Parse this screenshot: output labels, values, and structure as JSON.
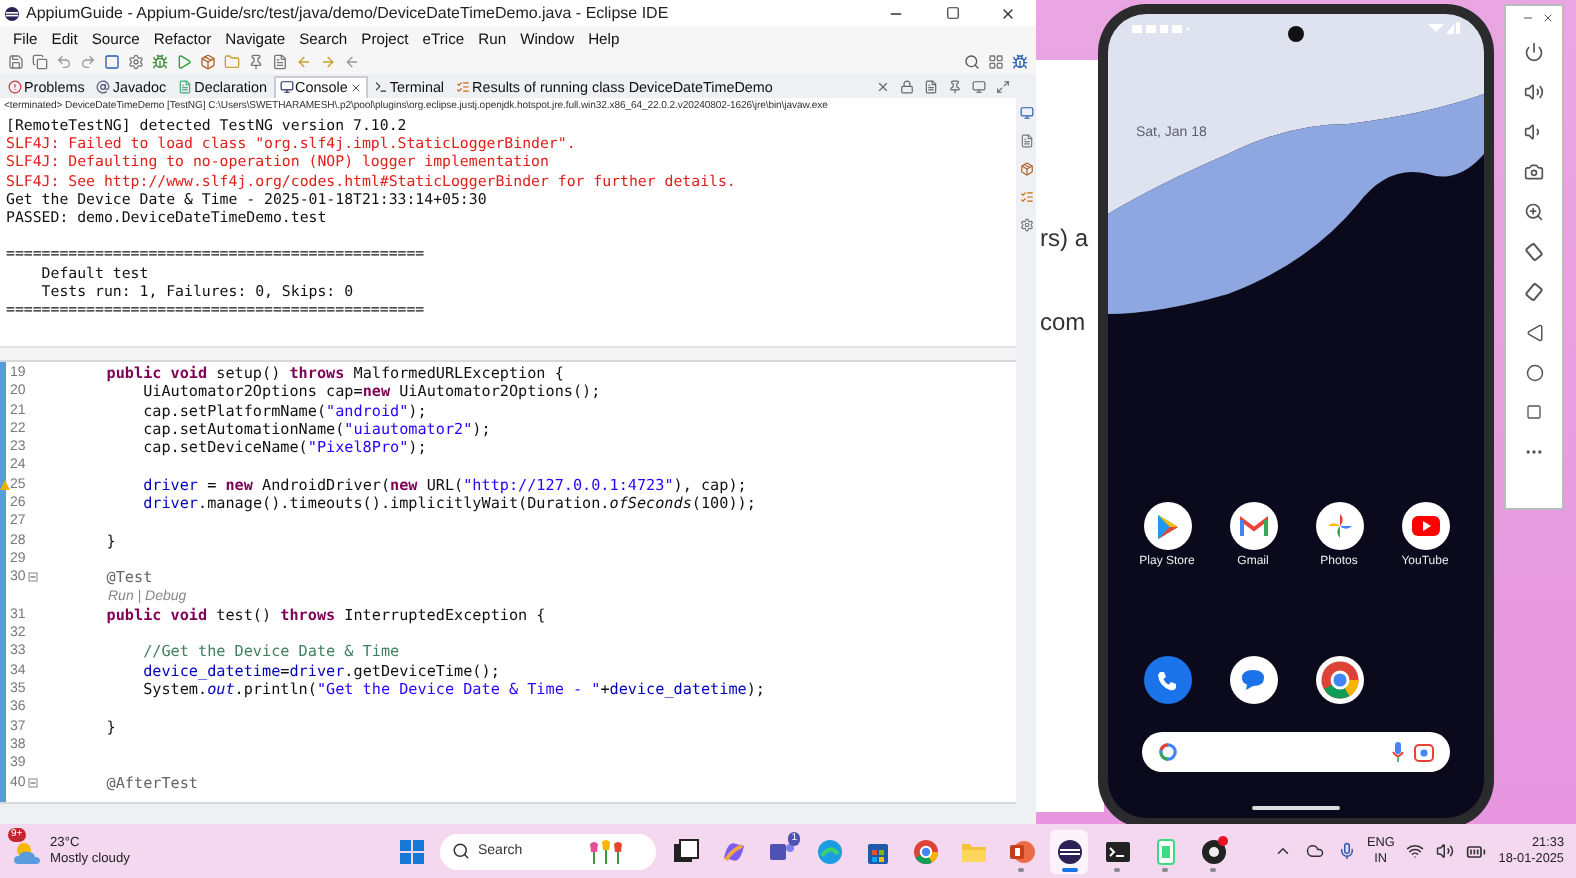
{
  "ide": {
    "title": "AppiumGuide - Appium-Guide/src/test/java/demo/DeviceDateTimeDemo.java - Eclipse IDE",
    "menu": [
      "File",
      "Edit",
      "Source",
      "Refactor",
      "Navigate",
      "Search",
      "Project",
      "eTrice",
      "Run",
      "Window",
      "Help"
    ],
    "tabs": [
      {
        "label": "Problems",
        "selected": false
      },
      {
        "label": "Javadoc",
        "selected": false
      },
      {
        "label": "Declaration",
        "selected": false
      },
      {
        "label": "Console",
        "selected": true
      },
      {
        "label": "Terminal",
        "selected": false
      },
      {
        "label": "Results of running class DeviceDateTimeDemo",
        "selected": false
      }
    ],
    "console": {
      "header": "<terminated> DeviceDateTimeDemo [TestNG] C:\\Users\\SWETHARAMESH\\.p2\\pool\\plugins\\org.eclipse.justj.openjdk.hotspot.jre.full.win32.x86_64_22.0.2.v20240802-1626\\jre\\bin\\javaw.exe",
      "blocks": [
        {
          "lines": [
            {
              "text": "[RemoteTestNG] detected TestNG version 7.10.2",
              "kind": "output"
            },
            {
              "text": "SLF4J: Failed to load class \"org.slf4j.impl.StaticLoggerBinder\".",
              "kind": "error"
            },
            {
              "text": "SLF4J: Defaulting to no-operation (NOP) logger implementation",
              "kind": "error"
            },
            {
              "text": "SLF4J: See http://www.slf4j.org/codes.html#StaticLoggerBinder for further details.",
              "kind": "error"
            },
            {
              "text": "Get the Device Date & Time - 2025-01-18T21:33:14+05:30",
              "kind": "output"
            },
            {
              "text": "PASSED: demo.DeviceDateTimeDemo.test",
              "kind": "output"
            }
          ]
        },
        {
          "lines": [
            {
              "text": "===============================================",
              "kind": "output"
            },
            {
              "text": "    Default test",
              "kind": "output"
            },
            {
              "text": "    Tests run: 1, Failures: 0, Skips: 0",
              "kind": "output"
            },
            {
              "text": "===============================================",
              "kind": "output"
            }
          ]
        }
      ]
    },
    "editor": {
      "lines": [
        {
          "number": "19",
          "tokens": [
            {
              "text": "    public",
              "kind": "keyword"
            },
            {
              "text": " void",
              "kind": "keyword"
            },
            {
              "text": " setup() ",
              "kind": "plain"
            },
            {
              "text": "throws",
              "kind": "keyword"
            },
            {
              "text": " MalformedURLException {",
              "kind": "plain"
            }
          ]
        },
        {
          "number": "20",
          "tokens": [
            {
              "text": "        UiAutomator2Options cap=",
              "kind": "plain"
            },
            {
              "text": "new",
              "kind": "keyword"
            },
            {
              "text": " UiAutomator2Options();",
              "kind": "plain"
            }
          ]
        },
        {
          "number": "21",
          "tokens": [
            {
              "text": "        cap.setPlatformName(",
              "kind": "plain"
            },
            {
              "text": "\"android\"",
              "kind": "string"
            },
            {
              "text": ");",
              "kind": "plain"
            }
          ]
        },
        {
          "number": "22",
          "tokens": [
            {
              "text": "        cap.setAutomationName(",
              "kind": "plain"
            },
            {
              "text": "\"uiautomator2\"",
              "kind": "string"
            },
            {
              "text": ");",
              "kind": "plain"
            }
          ]
        },
        {
          "number": "23",
          "tokens": [
            {
              "text": "        cap.setDeviceName(",
              "kind": "plain"
            },
            {
              "text": "\"Pixel8Pro\"",
              "kind": "string"
            },
            {
              "text": ");",
              "kind": "plain"
            }
          ]
        },
        {
          "number": "24"
        },
        {
          "number": "25",
          "warning": true,
          "tokens": [
            {
              "text": "        driver",
              "kind": "field"
            },
            {
              "text": " = ",
              "kind": "plain"
            },
            {
              "text": "new",
              "kind": "keyword"
            },
            {
              "text": " AndroidDriver(",
              "kind": "plain"
            },
            {
              "text": "new",
              "kind": "keyword"
            },
            {
              "text": " URL(",
              "kind": "plain"
            },
            {
              "text": "\"http://127.0.0.1:4723\"",
              "kind": "string"
            },
            {
              "text": "), cap);",
              "kind": "plain"
            }
          ]
        },
        {
          "number": "26",
          "tokens": [
            {
              "text": "        driver",
              "kind": "field"
            },
            {
              "text": ".manage().timeouts().implicitlyWait(Duration.",
              "kind": "plain"
            },
            {
              "text": "ofSeconds",
              "kind": "static_method"
            },
            {
              "text": "(100));",
              "kind": "plain"
            }
          ]
        },
        {
          "number": "27"
        },
        {
          "number": "28",
          "tokens": [
            {
              "text": "    }",
              "kind": "plain"
            }
          ]
        },
        {
          "number": "29"
        },
        {
          "number": "30",
          "folding": true,
          "tokens": [
            {
              "text": "    @Test",
              "kind": "annotation"
            }
          ]
        },
        {
          "mining": "Run | Debug"
        },
        {
          "number": "31",
          "tokens": [
            {
              "text": "    public",
              "kind": "keyword"
            },
            {
              "text": " void",
              "kind": "keyword"
            },
            {
              "text": " test() ",
              "kind": "plain"
            },
            {
              "text": "throws",
              "kind": "keyword"
            },
            {
              "text": " InterruptedException {",
              "kind": "plain"
            }
          ]
        },
        {
          "number": "32"
        },
        {
          "number": "33",
          "tokens": [
            {
              "text": "        //Get the Device Date & Time",
              "kind": "comment"
            }
          ]
        },
        {
          "number": "34",
          "tokens": [
            {
              "text": "        device_datetime",
              "kind": "field"
            },
            {
              "text": "=",
              "kind": "plain"
            },
            {
              "text": "driver",
              "kind": "field"
            },
            {
              "text": ".getDeviceTime();",
              "kind": "plain"
            }
          ]
        },
        {
          "number": "35",
          "tokens": [
            {
              "text": "        System.",
              "kind": "plain"
            },
            {
              "text": "out",
              "kind": "static_field"
            },
            {
              "text": ".println(",
              "kind": "plain"
            },
            {
              "text": "\"Get the Device Date & Time - \"",
              "kind": "string"
            },
            {
              "text": "+",
              "kind": "plain"
            },
            {
              "text": "device_datetime",
              "kind": "field"
            },
            {
              "text": ");",
              "kind": "plain"
            }
          ]
        },
        {
          "number": "36"
        },
        {
          "number": "37",
          "tokens": [
            {
              "text": "    }",
              "kind": "plain"
            }
          ]
        },
        {
          "number": "38"
        },
        {
          "number": "39"
        },
        {
          "number": "40",
          "folding": true,
          "tokens": [
            {
              "text": "    @AfterTest",
              "kind": "annotation"
            }
          ]
        }
      ]
    }
  },
  "background_document": {
    "texts": [
      "rs) a",
      "com"
    ]
  },
  "phone": {
    "date": "Sat, Jan 18",
    "apps": [
      {
        "label": "Play Store",
        "kind": "play"
      },
      {
        "label": "Gmail",
        "kind": "mail"
      },
      {
        "label": "Photos",
        "kind": "pinwheel"
      },
      {
        "label": "YouTube",
        "kind": "video"
      }
    ],
    "dock": [
      {
        "kind": "phone"
      },
      {
        "kind": "messages"
      },
      {
        "kind": "browser"
      }
    ]
  },
  "taskbar": {
    "weather": {
      "badge": "9+",
      "temperature": "23°C",
      "condition": "Mostly cloudy"
    },
    "search": {
      "placeholder": "Search"
    },
    "apps": [
      {
        "kind": "task-view",
        "running": false,
        "selected": false,
        "alert": false
      },
      {
        "kind": "copilot",
        "running": false,
        "selected": false,
        "alert": false
      },
      {
        "kind": "teams",
        "running": false,
        "selected": false,
        "alert": false,
        "badge": "1"
      },
      {
        "kind": "edge",
        "running": false,
        "selected": false,
        "alert": false
      },
      {
        "kind": "store",
        "running": false,
        "selected": false,
        "alert": false
      },
      {
        "kind": "chrome",
        "running": false,
        "selected": false,
        "alert": false
      },
      {
        "kind": "folder",
        "running": false,
        "selected": false,
        "alert": false
      },
      {
        "kind": "slides",
        "running": true,
        "selected": false,
        "alert": false
      },
      {
        "kind": "eclipse",
        "running": true,
        "selected": true,
        "alert": false
      },
      {
        "kind": "terminal",
        "running": true,
        "selected": false,
        "alert": false
      },
      {
        "kind": "emulator",
        "running": true,
        "selected": false,
        "alert": false
      },
      {
        "kind": "github",
        "running": true,
        "selected": false,
        "alert": true
      }
    ],
    "tray": {
      "language": "ENG",
      "region": "IN",
      "time": "21:33",
      "date": "18-01-2025"
    }
  }
}
